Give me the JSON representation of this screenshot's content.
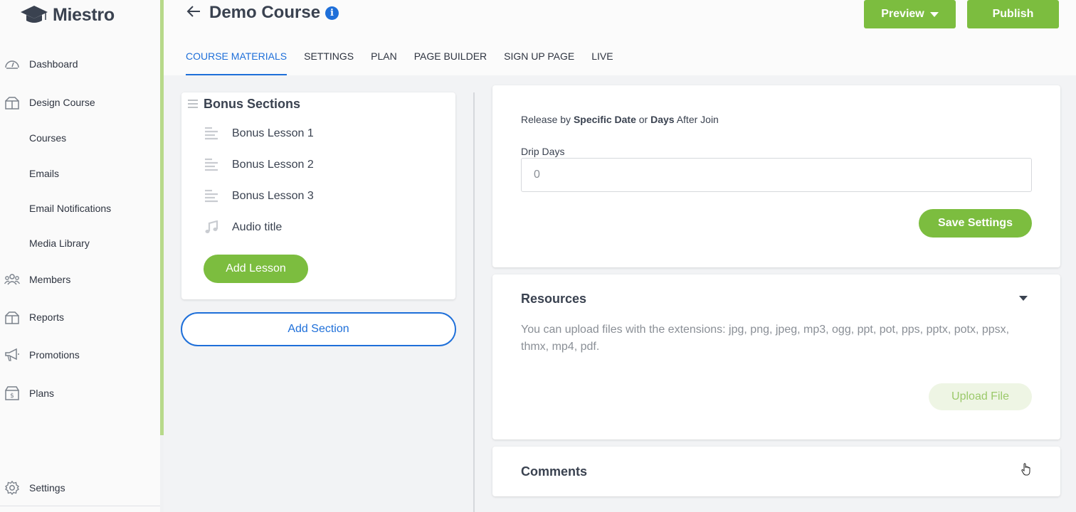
{
  "brand": {
    "name": "Miestro",
    "icon": "graduation-cap-icon"
  },
  "sidebar": {
    "items": [
      {
        "label": "Dashboard",
        "icon": "gauge-icon"
      },
      {
        "label": "Design Course",
        "icon": "box-icon"
      },
      {
        "label": "Courses",
        "icon": ""
      },
      {
        "label": "Emails",
        "icon": ""
      },
      {
        "label": "Email Notifications",
        "icon": ""
      },
      {
        "label": "Media Library",
        "icon": ""
      },
      {
        "label": "Members",
        "icon": "users-icon"
      },
      {
        "label": "Reports",
        "icon": "box-icon"
      },
      {
        "label": "Promotions",
        "icon": "megaphone-icon"
      },
      {
        "label": "Plans",
        "icon": "dollar-box-icon"
      },
      {
        "label": "Settings",
        "icon": "gear-icon"
      }
    ]
  },
  "header": {
    "title": "Demo Course",
    "preview_label": "Preview",
    "publish_label": "Publish",
    "tabs": [
      "COURSE MATERIALS",
      "SETTINGS",
      "PLAN",
      "PAGE BUILDER",
      "SIGN UP PAGE",
      "LIVE"
    ],
    "active_tab": "COURSE MATERIALS"
  },
  "section": {
    "title": "Bonus Sections",
    "lessons": [
      {
        "label": "Bonus Lesson 1",
        "icon": "text-lines-icon"
      },
      {
        "label": "Bonus Lesson 2",
        "icon": "text-lines-icon"
      },
      {
        "label": "Bonus Lesson 3",
        "icon": "text-lines-icon"
      },
      {
        "label": "Audio title",
        "icon": "music-note-icon"
      }
    ],
    "add_lesson_label": "Add Lesson",
    "add_section_label": "Add Section"
  },
  "drip": {
    "release_prefix": "Release by",
    "release_opt1": "Specific Date",
    "release_or": "or",
    "release_opt2": "Days",
    "release_suffix": "After Join",
    "label": "Drip Days",
    "value": "0",
    "save_label": "Save Settings"
  },
  "resources": {
    "title": "Resources",
    "description": "You can upload files with the extensions: jpg, png, jpeg, mp3, ogg, ppt, pot, pps, pptx, potx, ppsx, thmx, mp4, pdf.",
    "upload_label": "Upload File"
  },
  "comments": {
    "title": "Comments"
  },
  "colors": {
    "accent_green": "#7cbd3f",
    "accent_blue": "#1e6fd9",
    "text_dark": "#3a4250",
    "text_muted": "#8a8f96"
  }
}
